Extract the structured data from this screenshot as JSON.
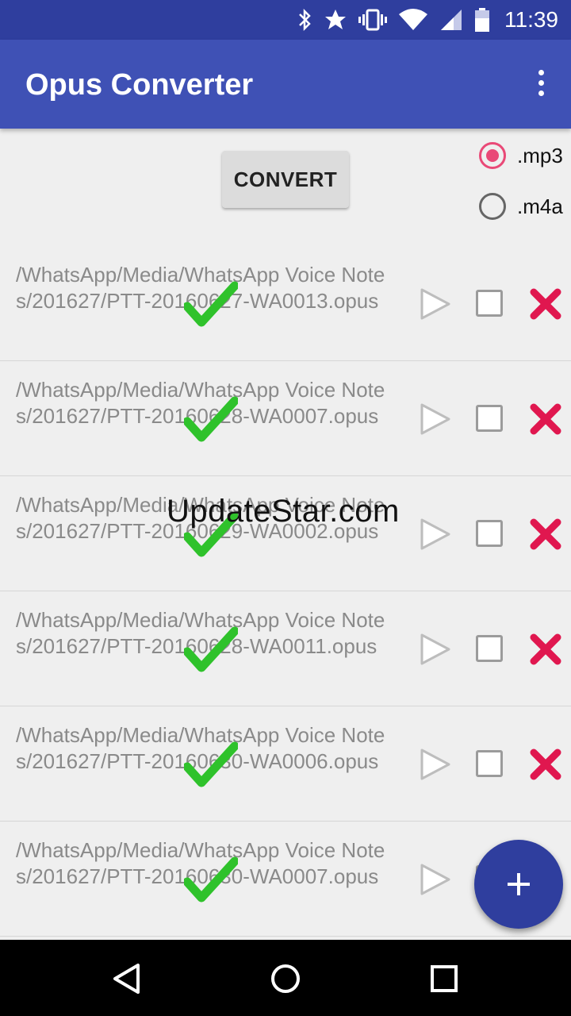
{
  "status_bar": {
    "time": "11:39",
    "icons": [
      "bluetooth-icon",
      "star-icon",
      "vibrate-icon",
      "wifi-icon",
      "signal-icon",
      "battery-icon"
    ]
  },
  "app_bar": {
    "title": "Opus Converter",
    "menu_icon": "overflow-menu-icon"
  },
  "convert_button": {
    "label": "CONVERT"
  },
  "format_options": [
    {
      "label": ".mp3",
      "selected": true
    },
    {
      "label": ".m4a",
      "selected": false
    }
  ],
  "files": [
    {
      "path": "/WhatsApp/Media/WhatsApp Voice Notes/201627/PTT-20160627-WA0013.opus"
    },
    {
      "path": "/WhatsApp/Media/WhatsApp Voice Notes/201627/PTT-20160628-WA0007.opus"
    },
    {
      "path": "/WhatsApp/Media/WhatsApp Voice Notes/201627/PTT-20160629-WA0002.opus"
    },
    {
      "path": "/WhatsApp/Media/WhatsApp Voice Notes/201627/PTT-20160628-WA0011.opus"
    },
    {
      "path": "/WhatsApp/Media/WhatsApp Voice Notes/201627/PTT-20160630-WA0006.opus"
    },
    {
      "path": "/WhatsApp/Media/WhatsApp Voice Notes/201627/PTT-20160630-WA0007.opus"
    }
  ],
  "watermark": "UpdateStar.com",
  "fab_icon": "plus-icon",
  "colors": {
    "status_bar": "#2f3e9e",
    "app_bar": "#3f51b5",
    "accent": "#e94977",
    "check_green": "#2fc22b",
    "delete_red": "#e0174f"
  },
  "nav_bar": {
    "icons": [
      "back-icon",
      "home-icon",
      "recents-icon"
    ]
  }
}
